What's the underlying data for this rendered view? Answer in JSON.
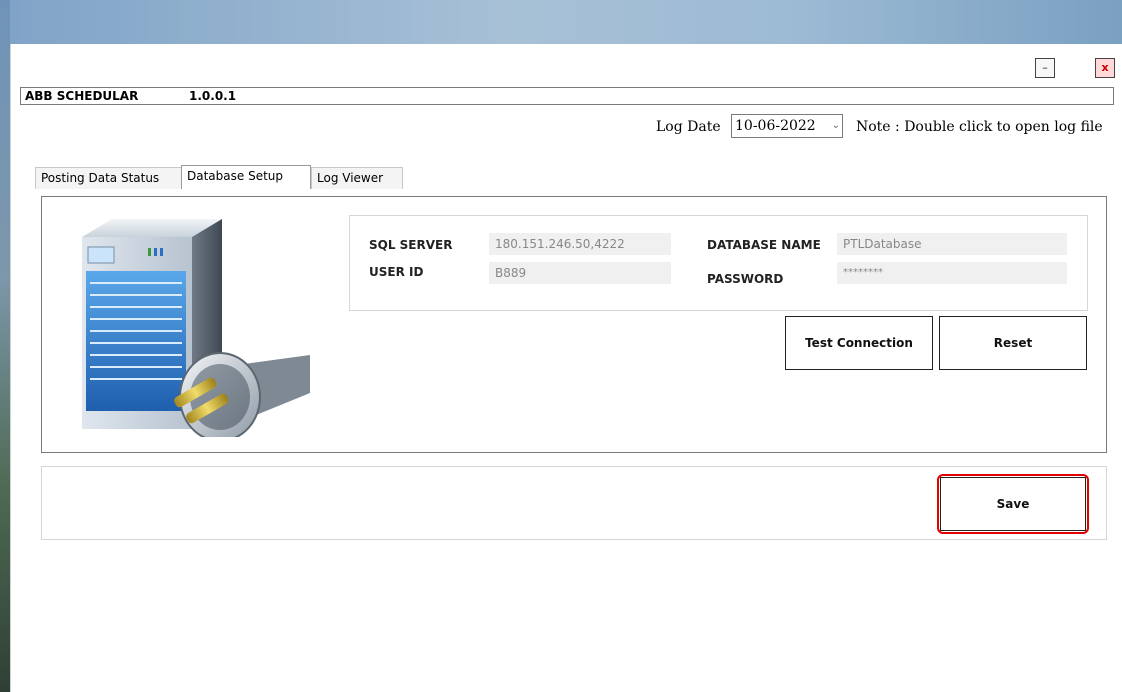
{
  "window": {
    "minimize_label": "–",
    "close_label": "x"
  },
  "header": {
    "app_name": "ABB SCHEDULAR",
    "version": "1.0.0.1"
  },
  "log": {
    "label": "Log Date",
    "date_value": "10-06-2022",
    "note": "Note : Double click to open log file"
  },
  "tabs": [
    {
      "label": "Posting Data Status"
    },
    {
      "label": "Database Setup",
      "selected": true
    },
    {
      "label": "Log Viewer"
    }
  ],
  "db_setup": {
    "sql_server_label": "SQL SERVER",
    "sql_server_value": "180.151.246.50,4222",
    "database_name_label": "DATABASE NAME",
    "database_name_value": "PTLDatabase",
    "user_id_label": "USER ID",
    "user_id_value": "B889",
    "password_label": "PASSWORD",
    "password_value": "********",
    "test_connection_label": "Test Connection",
    "reset_label": "Reset",
    "save_label": "Save"
  },
  "icons": [
    "server-icon",
    "plug-icon",
    "chevron-down-icon"
  ],
  "colors": {
    "highlight": "#e00000",
    "input_bg": "#f0f0f0"
  }
}
